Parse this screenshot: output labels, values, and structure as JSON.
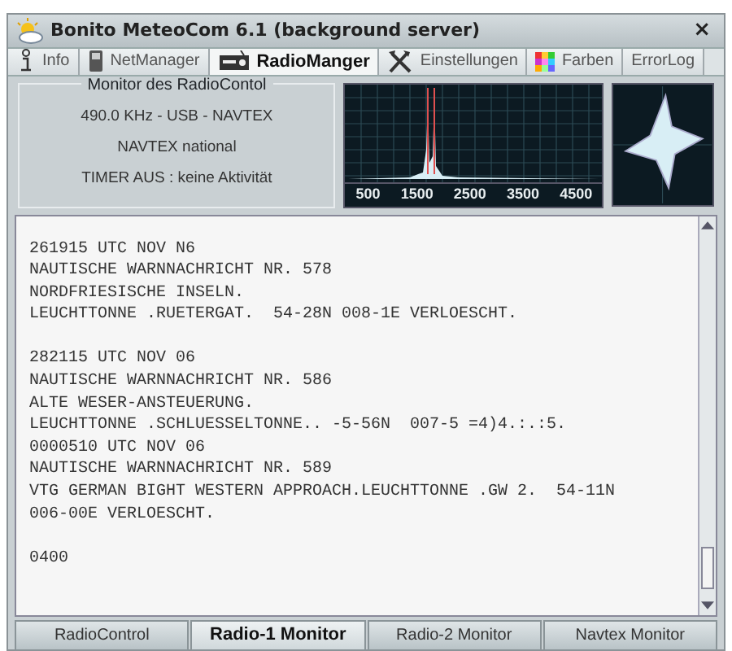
{
  "window": {
    "title": "Bonito MeteoCom 6.1 (background server)",
    "close": "×"
  },
  "tabs": [
    {
      "label": "Info",
      "kind": "info",
      "selected": false
    },
    {
      "label": "NetManager",
      "kind": "phone",
      "selected": false
    },
    {
      "label": "RadioManger",
      "kind": "radio",
      "selected": true
    },
    {
      "label": "Einstellungen",
      "kind": "tools",
      "selected": false
    },
    {
      "label": "Farben",
      "kind": "colors",
      "selected": false
    },
    {
      "label": "ErrorLog",
      "kind": "plain",
      "selected": false
    }
  ],
  "monitor": {
    "title": "Monitor des RadioContol",
    "lines": [
      "490.0 KHz - USB - NAVTEX",
      "NAVTEX national",
      "TIMER AUS : keine Aktivität"
    ]
  },
  "spectrum": {
    "axis_labels": [
      "500",
      "1500",
      "2500",
      "3500",
      "4500"
    ]
  },
  "log_blocks": [
    [
      "261915 UTC NOV N6",
      "NAUTISCHE WARNNACHRICHT NR. 578",
      "NORDFRIESISCHE INSELN.",
      "LEUCHTTONNE .RUETERGAT.  54-28N 008-1E VERLOESCHT."
    ],
    [
      "282115 UTC NOV 06",
      "NAUTISCHE WARNNACHRICHT NR. 586",
      "ALTE WESER-ANSTEUERUNG.",
      "LEUCHTTONNE .SCHLUESSELTONNE.. -5-56N  007-5 =4)4.:.:5.",
      "0000510 UTC NOV 06",
      "NAUTISCHE WARNNACHRICHT NR. 589",
      "VTG GERMAN BIGHT WESTERN APPROACH.LEUCHTTONNE .GW 2.  54-11N",
      "006-00E VERLOESCHT."
    ],
    [
      "0400"
    ]
  ],
  "bottom_tabs": [
    {
      "label": "RadioControl",
      "selected": false
    },
    {
      "label": "Radio-1 Monitor",
      "selected": true
    },
    {
      "label": "Radio-2 Monitor",
      "selected": false
    },
    {
      "label": "Navtex Monitor",
      "selected": false
    }
  ]
}
